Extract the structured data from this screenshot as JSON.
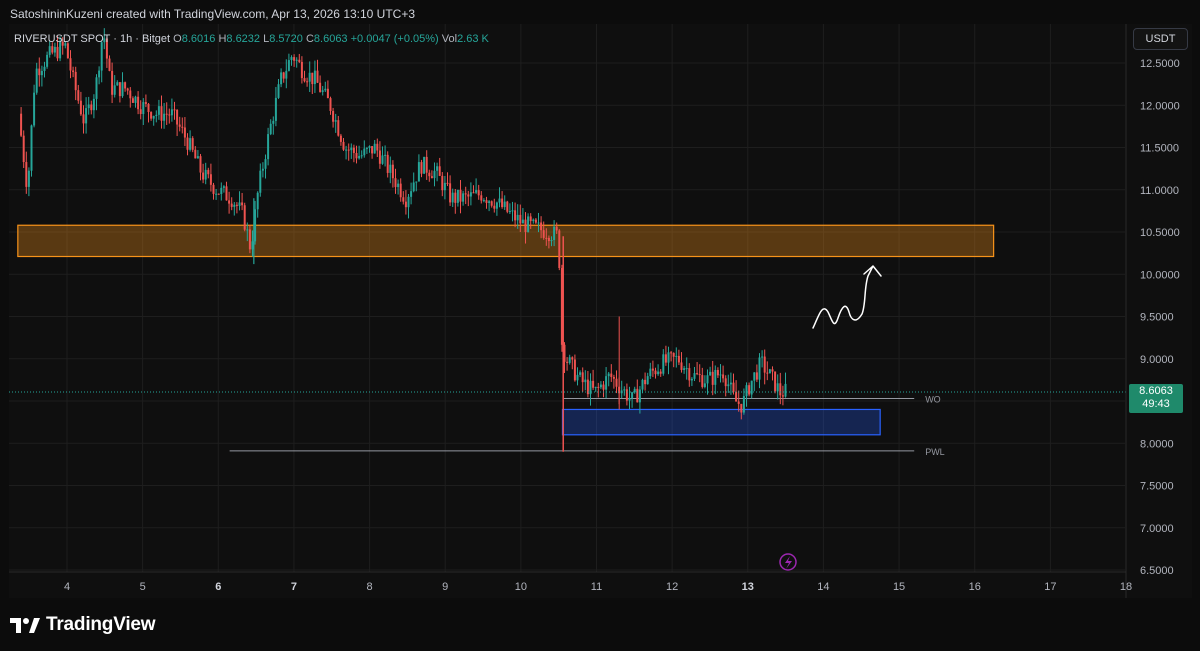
{
  "header": {
    "credit": "SatoshininKuzeni created with TradingView.com, Apr 13, 2026 13:10 UTC+3"
  },
  "legend": {
    "symbol": "RIVERUSDT SPOT · 1h · Bitget",
    "open_label": "O",
    "open": "8.6016",
    "high_label": "H",
    "high": "8.6232",
    "low_label": "L",
    "low": "8.5720",
    "close_label": "C",
    "close": "8.6063",
    "change": "+0.0047 (+0.05%)",
    "vol_label": "Vol",
    "vol": "2.63 K"
  },
  "currency_button": "USDT",
  "price_tag": {
    "price": "8.6063",
    "countdown": "49:43"
  },
  "footer": {
    "brand": "TradingView"
  },
  "colors": {
    "up": "#26a69a",
    "down": "#ef5350",
    "zone_resistance": "#f7931a",
    "zone_demand": "#2962ff",
    "grid": "#1e1e1e",
    "background": "#0c0c0c"
  },
  "icons": {
    "logo": "tradingview-logo-icon",
    "lightning": "lightning-icon"
  },
  "chart_data": {
    "type": "candlestick",
    "symbol": "RIVERUSDT",
    "timeframe": "1h",
    "y_axis": {
      "ticks": [
        12.5,
        12.0,
        11.5,
        11.0,
        10.5,
        10.0,
        9.5,
        9.0,
        8.5,
        8.0,
        7.5,
        7.0,
        6.5
      ],
      "tick_labels": [
        "12.5000",
        "12.0000",
        "11.5000",
        "11.0000",
        "10.5000",
        "10.0000",
        "9.5000",
        "9.0000",
        "8.5000",
        "8.0000",
        "7.5000",
        "7.0000",
        "6.5000"
      ],
      "range": [
        6.5,
        12.9
      ]
    },
    "x_axis": {
      "ticks": [
        4,
        5,
        6,
        7,
        8,
        9,
        10,
        11,
        12,
        13,
        14,
        15,
        16,
        17,
        18
      ],
      "bold_ticks": [
        6,
        7,
        13
      ],
      "range": [
        3.35,
        18.2
      ]
    },
    "current_price": 8.6063,
    "zones": [
      {
        "name": "resistance-zone",
        "x_from": 3.35,
        "x_to": 16.25,
        "y_from": 10.21,
        "y_to": 10.58,
        "color": "#f7931a"
      },
      {
        "name": "demand-zone",
        "x_from": 10.55,
        "x_to": 14.75,
        "y_from": 8.1,
        "y_to": 8.4,
        "color": "#2962ff"
      }
    ],
    "levels": [
      {
        "label": "WO",
        "value": 8.53,
        "x_from": 10.55,
        "x_to": 15.2
      },
      {
        "label": "PWL",
        "value": 7.91,
        "x_from": 6.15,
        "x_to": 15.2
      }
    ],
    "path_points": [
      [
        3.38,
        11.9
      ],
      [
        3.5,
        11.0
      ],
      [
        3.6,
        12.4
      ],
      [
        3.8,
        12.6
      ],
      [
        4.0,
        12.7
      ],
      [
        4.1,
        12.3
      ],
      [
        4.25,
        11.8
      ],
      [
        4.4,
        12.2
      ],
      [
        4.5,
        12.9
      ],
      [
        4.6,
        12.2
      ],
      [
        4.8,
        12.2
      ],
      [
        5.0,
        12.0
      ],
      [
        5.2,
        11.9
      ],
      [
        5.4,
        11.9
      ],
      [
        5.6,
        11.6
      ],
      [
        5.8,
        11.2
      ],
      [
        6.0,
        11.0
      ],
      [
        6.2,
        10.9
      ],
      [
        6.35,
        10.7
      ],
      [
        6.45,
        10.3
      ],
      [
        6.55,
        11.0
      ],
      [
        6.7,
        11.7
      ],
      [
        6.85,
        12.3
      ],
      [
        7.0,
        12.6
      ],
      [
        7.15,
        12.4
      ],
      [
        7.3,
        12.3
      ],
      [
        7.5,
        12.0
      ],
      [
        7.7,
        11.5
      ],
      [
        7.9,
        11.4
      ],
      [
        8.1,
        11.5
      ],
      [
        8.3,
        11.2
      ],
      [
        8.5,
        10.9
      ],
      [
        8.7,
        11.3
      ],
      [
        8.9,
        11.2
      ],
      [
        9.1,
        10.9
      ],
      [
        9.3,
        10.9
      ],
      [
        9.5,
        10.95
      ],
      [
        9.7,
        10.85
      ],
      [
        9.9,
        10.7
      ],
      [
        10.05,
        10.6
      ],
      [
        10.2,
        10.55
      ],
      [
        10.4,
        10.5
      ],
      [
        10.52,
        10.45
      ],
      [
        10.56,
        9.2
      ],
      [
        10.62,
        9.0
      ],
      [
        10.8,
        8.75
      ],
      [
        11.0,
        8.6
      ],
      [
        11.2,
        8.8
      ],
      [
        11.35,
        8.65
      ],
      [
        11.5,
        8.5
      ],
      [
        11.7,
        8.8
      ],
      [
        11.9,
        8.95
      ],
      [
        12.1,
        9.0
      ],
      [
        12.3,
        8.8
      ],
      [
        12.5,
        8.75
      ],
      [
        12.7,
        8.85
      ],
      [
        12.85,
        8.5
      ],
      [
        12.95,
        8.45
      ],
      [
        13.05,
        8.7
      ],
      [
        13.2,
        8.95
      ],
      [
        13.35,
        8.75
      ],
      [
        13.45,
        8.6
      ],
      [
        13.52,
        8.61
      ]
    ],
    "annotation": "hand-drawn upward arrow"
  }
}
